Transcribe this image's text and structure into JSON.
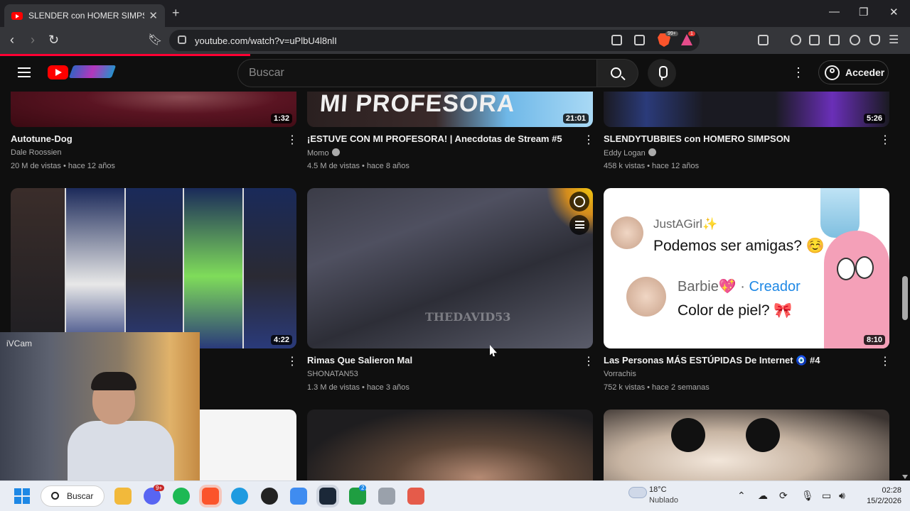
{
  "browser": {
    "tab_title": "SLENDER con HOMER SIMPSON",
    "url": "youtube.com/watch?v=uPlbU4l8nlI",
    "brave_badge": "99+",
    "rewards_badge": "1"
  },
  "youtube": {
    "search_placeholder": "Buscar",
    "sign_in_label": "Acceder"
  },
  "videos": [
    {
      "title": "Autotune-Dog",
      "channel": "Dale Roossien",
      "meta": "20 M de vistas • hace 12 años",
      "duration": "1:32",
      "verified": false
    },
    {
      "title": "¡ESTUVE CON MI PROFESORA! | Anecdotas de Stream #5",
      "channel": "Momo",
      "meta": "4.5 M de vistas • hace 8 años",
      "duration": "21:01",
      "verified": true,
      "thumb_text": "MI PROFESORA"
    },
    {
      "title": "SLENDYTUBBIES con HOMERO SIMPSON",
      "channel": "Eddy Logan",
      "meta": "458 k vistas • hace 12 años",
      "duration": "5:26",
      "verified": true
    },
    {
      "title": "",
      "channel": "",
      "meta": "",
      "duration": "4:22",
      "verified": false
    },
    {
      "title": "Rimas Que Salieron Mal",
      "channel": "SHONATAN53",
      "meta": "1.3 M de vistas • hace 3 años",
      "duration": "",
      "verified": false,
      "watermark": "THEDAVID53"
    },
    {
      "title": "Las Personas MÁS ESTÚPIDAS De Internet 🧿 #4",
      "channel": "Vorrachis",
      "meta": "752 k vistas • hace 2 semanas",
      "duration": "8:10",
      "verified": false
    }
  ],
  "chat_thumb": {
    "name1": "JustAGirl✨",
    "msg1": "Podemos ser amigas? ☺️",
    "name2": "Barbie💖",
    "sep": " · ",
    "creator": "Creador",
    "msg2": "Color de piel? 🎀"
  },
  "webcam": {
    "label": "iVCam"
  },
  "taskbar": {
    "search_label": "Buscar",
    "discord_badge": "9+",
    "xbox_badge": "2",
    "temperature": "18°C",
    "condition": "Nublado",
    "time": "02:28",
    "date": "15/2/2026"
  },
  "colors": {
    "accent": "#ff0000",
    "bg": "#0f0f0f",
    "creator_blue": "#1e88e5"
  }
}
